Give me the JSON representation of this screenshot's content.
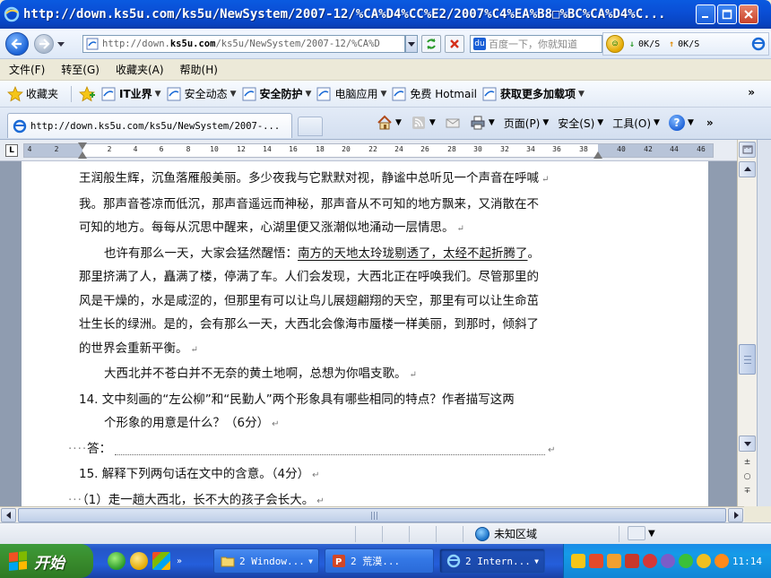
{
  "window": {
    "title": "http://down.ks5u.com/ks5u/NewSystem/2007-12/%CA%D4%CC%E2/2007%C4%EA%B8□%BC%CA%D4%C..."
  },
  "address_bar": {
    "url_prefix": "http://down.",
    "url_domain": "ks5u.com",
    "url_suffix": "/ks5u/NewSystem/2007-12/%CA%D",
    "search_placeholder": "百度一下，你就知道",
    "download_speed": "0K/S",
    "upload_speed": "0K/S"
  },
  "menu": {
    "items": [
      "文件(F)",
      "转至(G)",
      "收藏夹(A)",
      "帮助(H)"
    ]
  },
  "favorites_bar": {
    "favorites_label": "收藏夹",
    "items": [
      {
        "label": "IT业界",
        "bold": true
      },
      {
        "label": "安全动态",
        "bold": false
      },
      {
        "label": "安全防护",
        "bold": true
      },
      {
        "label": "电脑应用",
        "bold": false
      },
      {
        "label": "免费 Hotmail",
        "bold": false
      },
      {
        "label": "获取更多加载项",
        "bold": true
      }
    ]
  },
  "tab": {
    "title": "http://down.ks5u.com/ks5u/NewSystem/2007-..."
  },
  "command_bar": {
    "page_label": "页面(P)",
    "safety_label": "安全(S)",
    "tools_label": "工具(O)"
  },
  "ruler": {
    "ticks": [
      "4",
      "2",
      "2",
      "4",
      "6",
      "8",
      "10",
      "12",
      "14",
      "16",
      "18",
      "20",
      "22",
      "24",
      "26",
      "28",
      "30",
      "32",
      "34",
      "36",
      "38",
      "40",
      "42",
      "44",
      "46"
    ]
  },
  "document": {
    "lines": [
      {
        "text": "王润般生辉，沉鱼落雁般美丽。多少夜我与它默默对视，静谧中总听见一个声音在呼喊",
        "ret": "↵",
        "style": "normal"
      },
      {
        "text": "我。那声音苍凉而低沉，那声音遥远而神秘，那声音从不可知的地方飘来，又消散在不",
        "ret": "",
        "style": "normal"
      },
      {
        "text": "可知的地方。每每从沉思中醒来，心湖里便又涨潮似地涌动一层情思。",
        "ret": "↵",
        "style": "normal"
      },
      {
        "text": "也许有那么一天，大家会猛然醒悟：",
        "underlined": "南方的天地太玲珑剔透了，太经不起折腾了",
        "tail": "。",
        "ret": "",
        "style": "indent"
      },
      {
        "text": "那里挤满了人，矗满了楼，停满了车。人们会发现，大西北正在呼唤我们。尽管那里的",
        "ret": "",
        "style": "normal"
      },
      {
        "text": "风是干燥的，水是咸涩的，但那里有可以让鸟儿展翅翩翔的天空，那里有可以让生命茁",
        "ret": "",
        "style": "normal"
      },
      {
        "text": "壮生长的绿洲。是的，会有那么一天，大西北会像海市蜃楼一样美丽，到那时，倾斜了",
        "ret": "",
        "style": "normal"
      },
      {
        "text": "的世界会重新平衡。",
        "ret": "↵",
        "style": "normal"
      },
      {
        "text": "大西北并不苍白并不无奈的黄土地啊，总想为你唱支歌。",
        "ret": "↵",
        "style": "indent"
      },
      {
        "text": "14.  文中刻画的“左公柳”和“民勤人”两个形象具有哪些相同的特点？作者描写这两",
        "ret": "",
        "style": "q"
      },
      {
        "text": "个形象的用意是什么？（6分）",
        "ret": "↵",
        "style": "q-indent"
      },
      {
        "text": "答：",
        "ret": "↵",
        "style": "answer"
      },
      {
        "text": "15.  解释下列两句话在文中的含意。（4分）",
        "ret": "↵",
        "style": "q"
      },
      {
        "text": "（1）走一趟大西北，长不大的孩子会长大。",
        "ret": "↵",
        "style": "sub"
      }
    ]
  },
  "status_bar": {
    "zone": "未知区域"
  },
  "taskbar": {
    "start_label": "开始",
    "buttons": [
      {
        "label": "2 Window...",
        "icon": "folder-icon"
      },
      {
        "label": "2 荒漠...",
        "icon": "powerpoint-icon"
      },
      {
        "label": "2 Intern...",
        "icon": "ie-icon"
      }
    ],
    "clock": "11:14"
  },
  "colors": {
    "title_bar": "#0a4fd6",
    "start_button": "#3a8e2e",
    "taskbar": "#245edb",
    "tray": "#159be8"
  }
}
